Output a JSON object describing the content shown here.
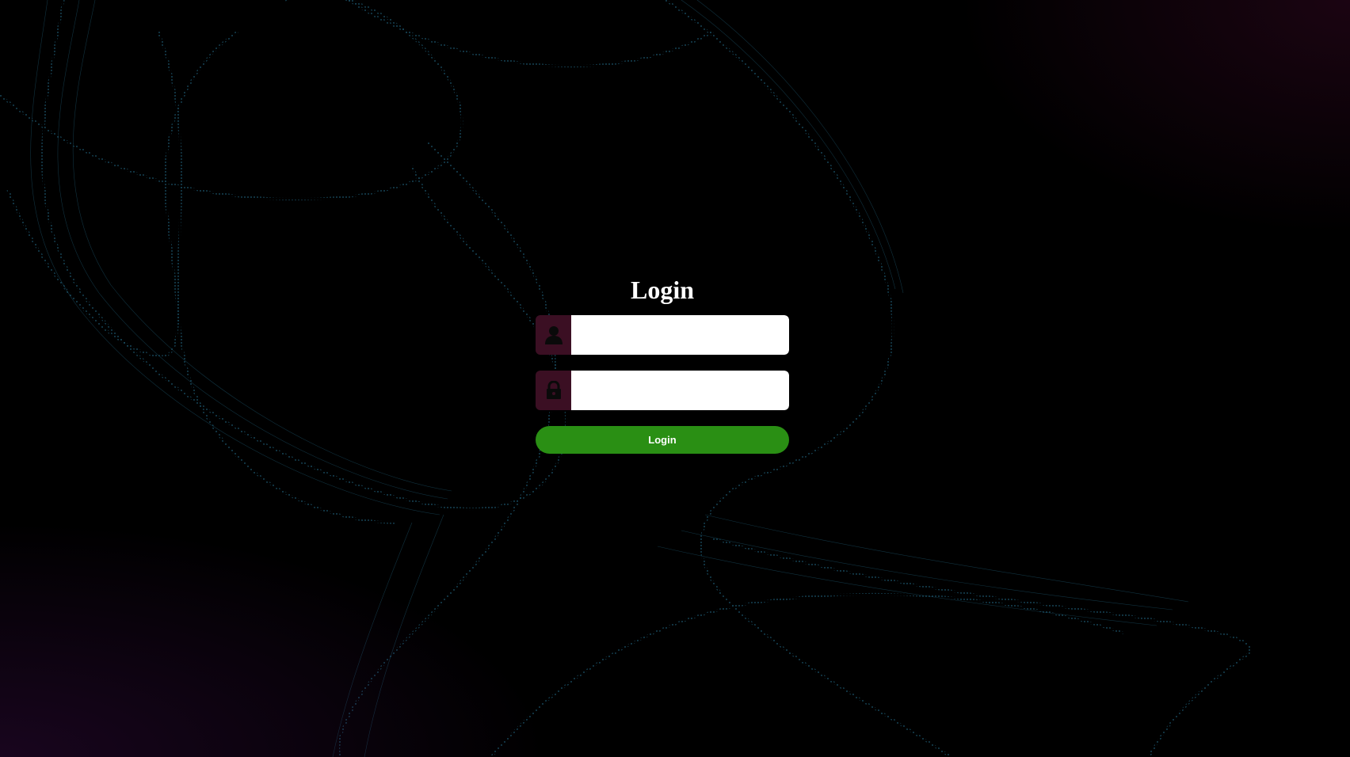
{
  "login": {
    "title": "Login",
    "username_placeholder": "",
    "password_placeholder": "",
    "submit_label": "Login"
  },
  "colors": {
    "background": "#000000",
    "wave": "#2a7fa0",
    "icon_box": "#3b0f23",
    "button": "#2a8f14"
  },
  "icons": {
    "username": "user-icon",
    "password": "lock-icon"
  }
}
